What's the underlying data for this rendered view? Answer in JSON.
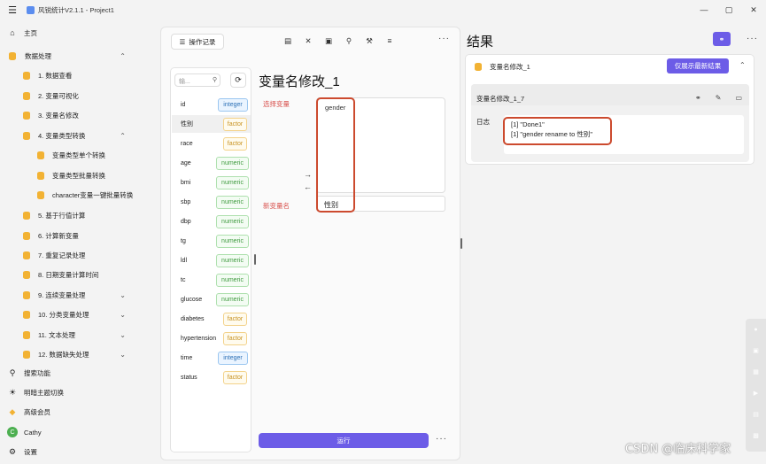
{
  "titlebar": {
    "title": "风锐统计V2.1.1 - Project1"
  },
  "sidebar": {
    "home": "主页",
    "data_processing": "数据处理",
    "items": [
      "1. 数据查看",
      "2. 变量可视化",
      "3. 变量名修改",
      "4. 变量类型转换",
      "变量类型单个转换",
      "变量类型批量转换",
      "character变量一键批量转换",
      "5. 基于行值计算",
      "6. 计算新变量",
      "7. 重复记录处理",
      "8. 日期变量计算时间",
      "9. 连续变量处理",
      "10. 分类变量处理",
      "11. 文本处理",
      "12. 数据缺失处理"
    ],
    "search": "搜索功能",
    "theme": "明暗主题切换",
    "vip": "高级会员",
    "user": "Cathy",
    "user_initial": "C",
    "settings": "设置"
  },
  "main": {
    "history_button": "操作记录",
    "search_placeholder": "输...",
    "panel_title": "变量名修改_1",
    "select_label": "选择变量",
    "new_name_label": "新变量名",
    "selected_var": "gender",
    "new_name_value": "性别",
    "run_button": "运行",
    "variables": [
      {
        "name": "id",
        "type": "integer"
      },
      {
        "name": "性别",
        "type": "factor"
      },
      {
        "name": "race",
        "type": "factor"
      },
      {
        "name": "age",
        "type": "numeric"
      },
      {
        "name": "bmi",
        "type": "numeric"
      },
      {
        "name": "sbp",
        "type": "numeric"
      },
      {
        "name": "dbp",
        "type": "numeric"
      },
      {
        "name": "tg",
        "type": "numeric"
      },
      {
        "name": "ldl",
        "type": "numeric"
      },
      {
        "name": "tc",
        "type": "numeric"
      },
      {
        "name": "glucose",
        "type": "numeric"
      },
      {
        "name": "diabetes",
        "type": "factor"
      },
      {
        "name": "hypertension",
        "type": "factor"
      },
      {
        "name": "time",
        "type": "integer"
      },
      {
        "name": "status",
        "type": "factor"
      }
    ]
  },
  "results": {
    "title": "结果",
    "card_title": "变量名修改_1",
    "latest_button": "仅展示最新结果",
    "sub_title": "变量名修改_1_7",
    "log_label": "日志",
    "log_lines": [
      "[1] \"Done1\"",
      "[1] \"gender rename to 性别\""
    ]
  },
  "watermark": "CSDN @临床科学家",
  "colors": {
    "accent": "#6c5ce7",
    "highlight_red": "#cc4a2e",
    "folder": "#f2b233"
  }
}
